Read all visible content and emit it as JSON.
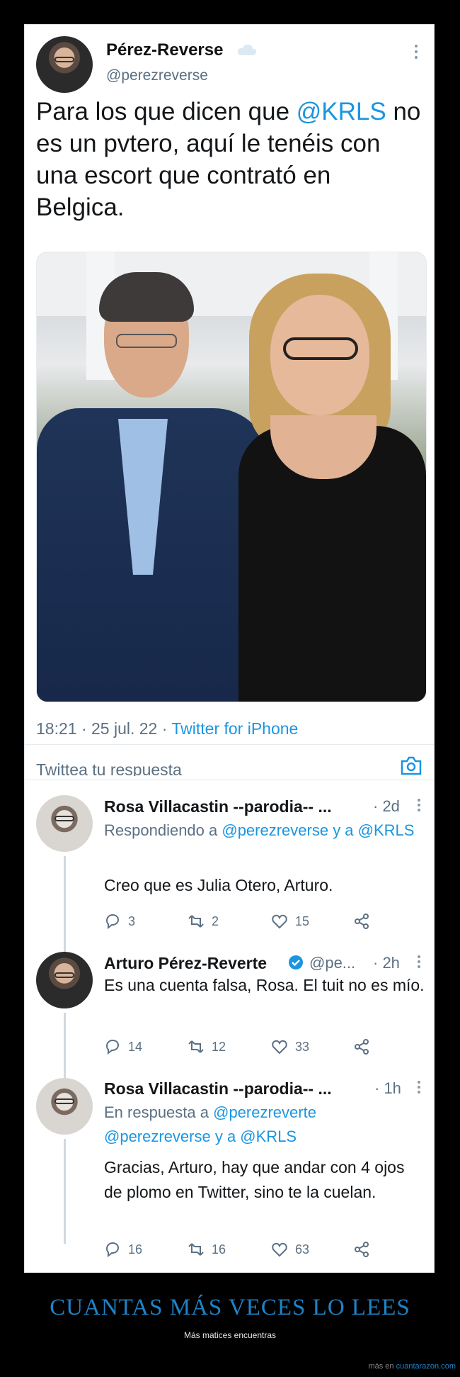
{
  "tweet": {
    "author_name": "Pérez-Reverse",
    "author_handle": "@perezreverse",
    "text_before": "Para los que dicen que ",
    "text_mention": "@KRLS",
    "text_after": " no es un pvtero, aquí le tenéis con una escort que contrató en Belgica.",
    "time": "18:21 · 25 jul. 22 · ",
    "source": "Twitter for iPhone",
    "reply_placeholder": "Twittea tu respuesta"
  },
  "replies": [
    {
      "name": "Rosa Villacastin --parodia-- ...",
      "time": "· 2d",
      "context_prefix": "Respondiendo a ",
      "context_mentions": "@perezreverse y a @KRLS",
      "text": "Creo que es Julia Otero, Arturo.",
      "reply_count": "3",
      "retweet_count": "2",
      "like_count": "15"
    },
    {
      "name": "Arturo Pérez-Reverte",
      "handle": "@pe...",
      "time": "· 2h",
      "text": "Es una cuenta falsa, Rosa. El tuit no es mío.",
      "reply_count": "14",
      "retweet_count": "12",
      "like_count": "33"
    },
    {
      "name": "Rosa Villacastin --parodia-- ...",
      "time": "· 1h",
      "context_prefix": "En respuesta a ",
      "context_mentions": "@perezreverte @perezreverse y a @KRLS",
      "text": "Gracias, Arturo, hay que andar con 4 ojos de plomo en Twitter, sino te la cuelan.",
      "reply_count": "16",
      "retweet_count": "16",
      "like_count": "63"
    }
  ],
  "caption": {
    "headline": "CUANTAS MÁS VECES LO LEES",
    "subline": "Más matices encuentras",
    "footer_prefix": "más en ",
    "footer_site": "cuantarazon.com"
  },
  "colors": {
    "link_blue": "#1b95e0",
    "headline_blue": "#1e83c6",
    "background": "#000000"
  }
}
